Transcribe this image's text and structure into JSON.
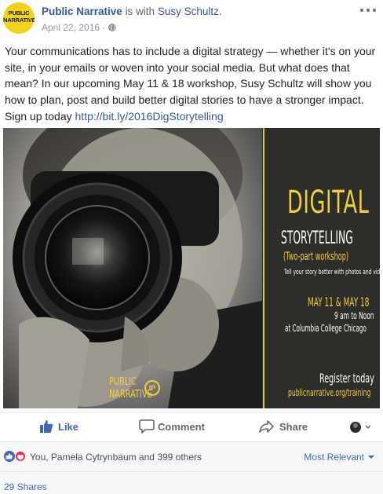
{
  "post": {
    "page_name": "Public Narrative",
    "is_with": "is with",
    "tagged_name": "Susy Schultz.",
    "date": "April 22, 2016 ·",
    "avatar_line1": "PUBLIC",
    "avatar_line2": "NARRATIVE",
    "text": "Your communications has to include a digital strategy — whether it's on your site, in your emails or woven into your social media. But what does that mean? In our upcoming May 11 & 18 workshop, Susy Schultz will show you how to plan, post and build better digital stories to have a stronger impact. Sign up today ",
    "link": "http://bit.ly/2016DigStorytelling"
  },
  "poster": {
    "title_1": "DIGITAL",
    "title_2": "STORYTELLING",
    "subtitle": "(Two-part workshop)",
    "tagline": "Tell your story better with photos and videos",
    "dates": "MAY 11 & MAY 18",
    "time": "9 am to Noon",
    "venue": "at Columbia College Chicago",
    "register": "Register today",
    "url": "publicnarrative.org/training",
    "watermark_1": "PUBLIC",
    "watermark_2": "NARRATIVE",
    "watermark_badge": "IP"
  },
  "actions": {
    "like": "Like",
    "comment": "Comment",
    "share": "Share"
  },
  "reactions": {
    "summary": "You, Pamela Cytrynbaum and 399 others",
    "sort": "Most Relevant"
  },
  "shares": {
    "count": "29 Shares"
  },
  "colors": {
    "link": "#365899",
    "accent": "#4267b2",
    "poster_yellow": "#f2cf3c",
    "love": "#f0284a"
  }
}
